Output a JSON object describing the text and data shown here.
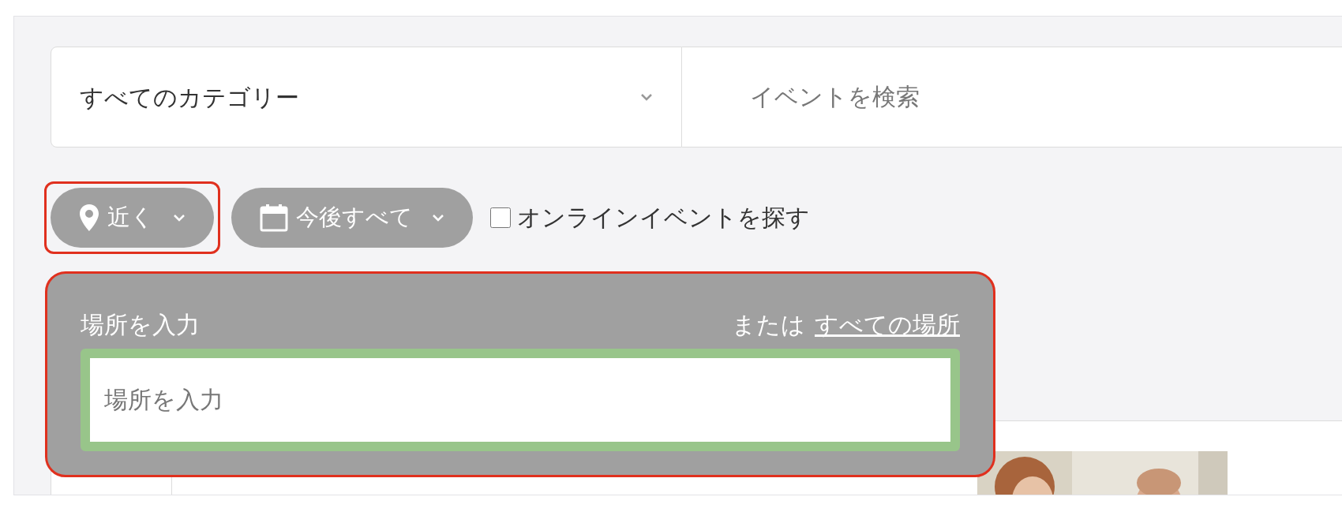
{
  "search_bar": {
    "category": "すべてのカテゴリー",
    "search_placeholder": "イベントを検索"
  },
  "filters": [
    {
      "kind": "chip",
      "label": "近く",
      "highlighted": true
    },
    {
      "kind": "chip",
      "label": "今後すべて",
      "highlighted": false
    },
    {
      "kind": "checkbox",
      "label": "オンラインイベントを探す",
      "checked": false
    }
  ],
  "location_popup": {
    "label": "場所を入力",
    "alt_prefix": "または",
    "alt_link": "すべての場所",
    "placeholder": "場所を入力",
    "highlighted": true
  }
}
